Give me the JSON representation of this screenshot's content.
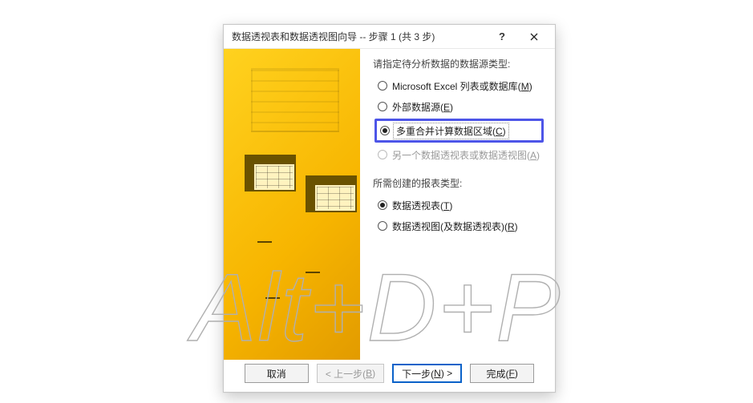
{
  "dialog": {
    "title": "数据透视表和数据透视图向导 -- 步骤 1 (共 3 步)"
  },
  "section1": {
    "label": "请指定待分析数据的数据源类型:",
    "options": [
      {
        "text": "Microsoft Excel 列表或数据库(",
        "accel": "M",
        "suffix": ")",
        "selected": false,
        "enabled": true
      },
      {
        "text": "外部数据源(",
        "accel": "E",
        "suffix": ")",
        "selected": false,
        "enabled": true
      },
      {
        "text": "多重合并计算数据区域(",
        "accel": "C",
        "suffix": ")",
        "selected": true,
        "enabled": true
      },
      {
        "text": "另一个数据透视表或数据透视图(",
        "accel": "A",
        "suffix": ")",
        "selected": false,
        "enabled": false
      }
    ]
  },
  "section2": {
    "label": "所需创建的报表类型:",
    "options": [
      {
        "text": "数据透视表(",
        "accel": "T",
        "suffix": ")",
        "selected": true,
        "enabled": true
      },
      {
        "text": "数据透视图(及数据透视表)(",
        "accel": "R",
        "suffix": ")",
        "selected": false,
        "enabled": true
      }
    ]
  },
  "buttons": {
    "cancel": "取消",
    "back_prefix": "< 上一步(",
    "back_accel": "B",
    "back_suffix": ")",
    "next_prefix": "下一步(",
    "next_accel": "N",
    "next_suffix": ") >",
    "finish_prefix": "完成(",
    "finish_accel": "F",
    "finish_suffix": ")"
  },
  "watermark": "Alt+D+P",
  "help_symbol": "?"
}
